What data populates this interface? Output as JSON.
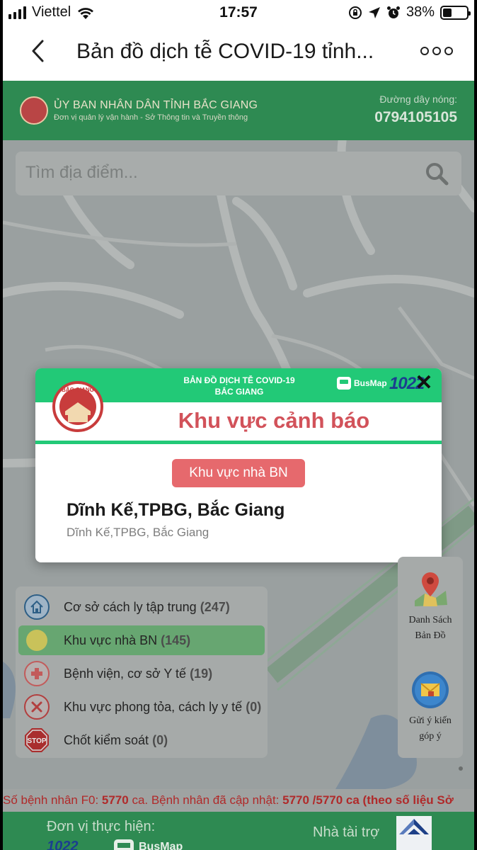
{
  "status_bar": {
    "carrier": "Viettel",
    "time": "17:57",
    "battery_percent": "38%",
    "battery_level": 0.38
  },
  "nav": {
    "title": "Bản đồ dịch tễ COVID-19 tỉnh...",
    "back_icon": "chevron-left-icon",
    "more_icon": "more-icon"
  },
  "header": {
    "org_name": "ỦY BAN NHÂN DÂN TỈNH BẮC GIANG",
    "org_sub": "Đơn vị quản lý vận hành - Sở Thông tin và Truyền thông",
    "hotline_label": "Đường dây nóng:",
    "hotline_number": "0794105105",
    "color": "#2e8a52"
  },
  "search": {
    "placeholder": "Tìm địa điểm..."
  },
  "modal": {
    "header_line1": "BẢN ĐỒ DỊCH TỄ COVID-19",
    "header_line2": "BẮC GIANG",
    "busmap_label": "BusMap",
    "logo_1022": "1022",
    "seal_text": "BẮC GIANG",
    "title": "Khu vực cảnh báo",
    "badge": "Khu vực nhà BN",
    "place_name": "Dĩnh Kế,TPBG, Bắc Giang",
    "address": "Dĩnh Kế,TPBG, Bắc Giang",
    "accent": "#22c977",
    "title_color": "#d2525a"
  },
  "legend": {
    "items": [
      {
        "label": "Cơ sở cách ly tập trung",
        "count": "(247)",
        "icon": "house-icon"
      },
      {
        "label": "Khu vực nhà BN",
        "count": "(145)",
        "icon": "yellow-dot-icon"
      },
      {
        "label": "Bệnh viện, cơ sở Y tế",
        "count": "(19)",
        "icon": "medical-cross-icon"
      },
      {
        "label": "Khu vực phong tỏa, cách ly y tế",
        "count": "(0)",
        "icon": "x-circle-icon"
      },
      {
        "label": "Chốt kiểm soát",
        "count": "(0)",
        "icon": "stop-sign-icon",
        "stop_text": "STOP"
      }
    ]
  },
  "side_panel": {
    "map_list_line1": "Danh Sách",
    "map_list_line2": "Bản Đồ",
    "feedback_line1": "Gửi ý kiến",
    "feedback_line2": "góp ý"
  },
  "ticker": {
    "part1": "Số bệnh nhân F0: ",
    "f0": "5770",
    "part2": " ca. Bệnh nhân đã cập nhật: ",
    "updated": "5770 /5770",
    "part3": " ca (theo số liệu Sở"
  },
  "footer": {
    "implementer_label": "Đơn vị thực hiện:",
    "sponsor_label": "Nhà tài trợ",
    "logo_1022": "1022",
    "busmap_label": "BusMap"
  }
}
